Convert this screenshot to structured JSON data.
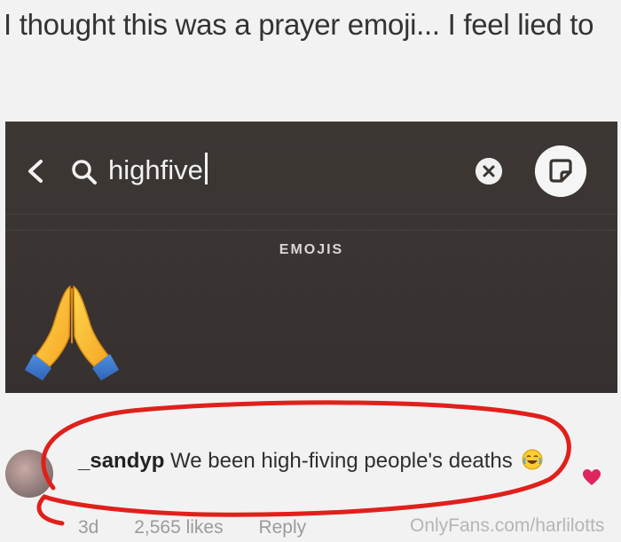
{
  "post": {
    "text": "I thought this was a prayer emoji... I feel lied to"
  },
  "emoji_search": {
    "query": "highfive",
    "section_label": "EMOJIS",
    "back_icon": "chevron-left-icon",
    "search_icon": "search-icon",
    "clear_icon": "clear-x-icon",
    "sticker_icon": "sticker-icon",
    "result_emoji": "folded-hands-emoji"
  },
  "comment": {
    "username": "_sandyp",
    "text": "We been high-fiving people's deaths",
    "emoji": "crying-laughing-emoji",
    "time": "3d",
    "likes": "2,565 likes",
    "reply_label": "Reply",
    "heart_color": "#e0245e"
  },
  "watermark": "OnlyFans.com/harlilotts",
  "colors": {
    "panel_bg": "#3a3431",
    "annotation_red": "#e0201b"
  }
}
